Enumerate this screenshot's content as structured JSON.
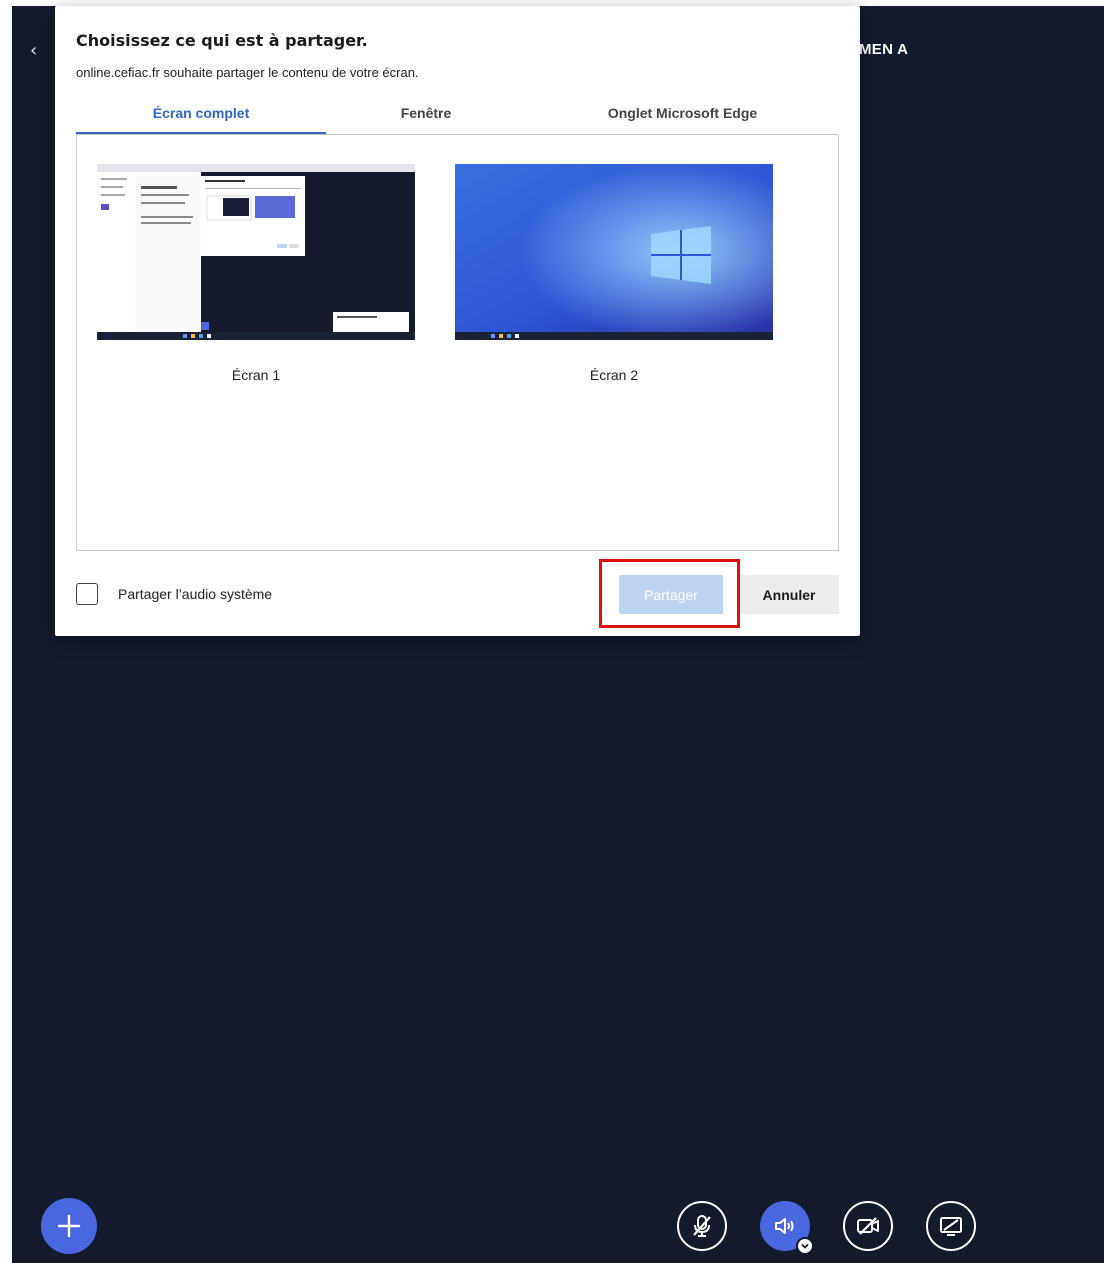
{
  "colors": {
    "background": "#131a2b",
    "accent": "#4a67e0",
    "tab_active": "#2f66c6",
    "share_disabled": "#bcd4ef",
    "highlight": "#e01010"
  },
  "app": {
    "room_title": "MEN A",
    "back_icon": "back-user-icon",
    "toolbar": {
      "plus_icon": "plus-icon",
      "buttons": [
        {
          "icon": "microphone-muted-icon"
        },
        {
          "icon": "speaker-icon",
          "state": "active"
        },
        {
          "icon": "camera-off-icon"
        },
        {
          "icon": "screen-share-off-icon"
        }
      ]
    }
  },
  "dialog": {
    "title": "Choisissez ce qui est à partager.",
    "subtitle": "online.cefiac.fr souhaite partager le contenu de votre écran.",
    "tabs": [
      {
        "label": "Écran complet",
        "active": true
      },
      {
        "label": "Fenêtre",
        "active": false
      },
      {
        "label": "Onglet Microsoft Edge",
        "active": false
      }
    ],
    "screens": [
      {
        "label": "Écran 1"
      },
      {
        "label": "Écran 2"
      }
    ],
    "audio_checkbox": {
      "label": "Partager l’audio système",
      "checked": false
    },
    "share_button": "Partager",
    "cancel_button": "Annuler"
  }
}
